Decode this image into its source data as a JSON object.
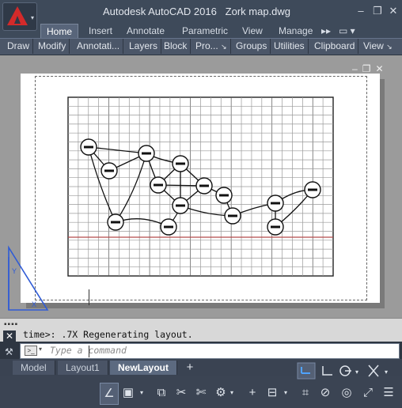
{
  "app": {
    "title": "Autodesk AutoCAD 2016",
    "filename": "Zork map.dwg",
    "app_button_chevron": "▾"
  },
  "window_controls": {
    "minimize": "–",
    "restore": "❐",
    "close": "✕"
  },
  "ribbon": {
    "tabs": [
      {
        "label": "Home",
        "active": true
      },
      {
        "label": "Insert"
      },
      {
        "label": "Annotate"
      },
      {
        "label": "Parametric"
      },
      {
        "label": "View"
      },
      {
        "label": "Manage"
      }
    ],
    "more_tabs": "▸▸",
    "extra_button": "▭ ▾"
  },
  "panels": [
    {
      "label": "Draw"
    },
    {
      "label": "Modify"
    },
    {
      "label": "Annotati..."
    },
    {
      "label": "Layers"
    },
    {
      "label": "Block"
    },
    {
      "label": "Pro...",
      "arrow": "↘"
    },
    {
      "label": "Groups"
    },
    {
      "label": "Utilities"
    },
    {
      "label": "Clipboard"
    },
    {
      "label": "View",
      "arrow": "↘"
    }
  ],
  "viewport_controls": {
    "minimize": "–",
    "restore": "❐",
    "close": "✕"
  },
  "command_line": {
    "history_dots": "▪▪▪▪",
    "history_text": "time>: .7X Regenerating layout.",
    "close": "✕",
    "wrench": "🔧",
    "prompt_icon": ">_",
    "dropdown": "▾",
    "placeholder": "Type a command"
  },
  "layout_tabs": [
    {
      "label": "Model"
    },
    {
      "label": "Layout1"
    },
    {
      "label": "NewLayout",
      "active": true
    }
  ],
  "add_layout": "+",
  "statusbar": {
    "top_icons": [
      "snap-grid",
      "ortho",
      "polar",
      "osnap-track"
    ],
    "bottom_icons": [
      "model-space",
      "viewport",
      "annotation-scale",
      "workspace",
      "gear",
      "plus",
      "tools",
      "isolate",
      "hardware",
      "clean-screen",
      "customize"
    ]
  },
  "colors": {
    "title_bar": "#3e4a5a",
    "logo_red": "#d32a2a",
    "paper": "#ffffff",
    "workspace": "#9b9b9b",
    "grid_red_line": "#b54a4a"
  }
}
